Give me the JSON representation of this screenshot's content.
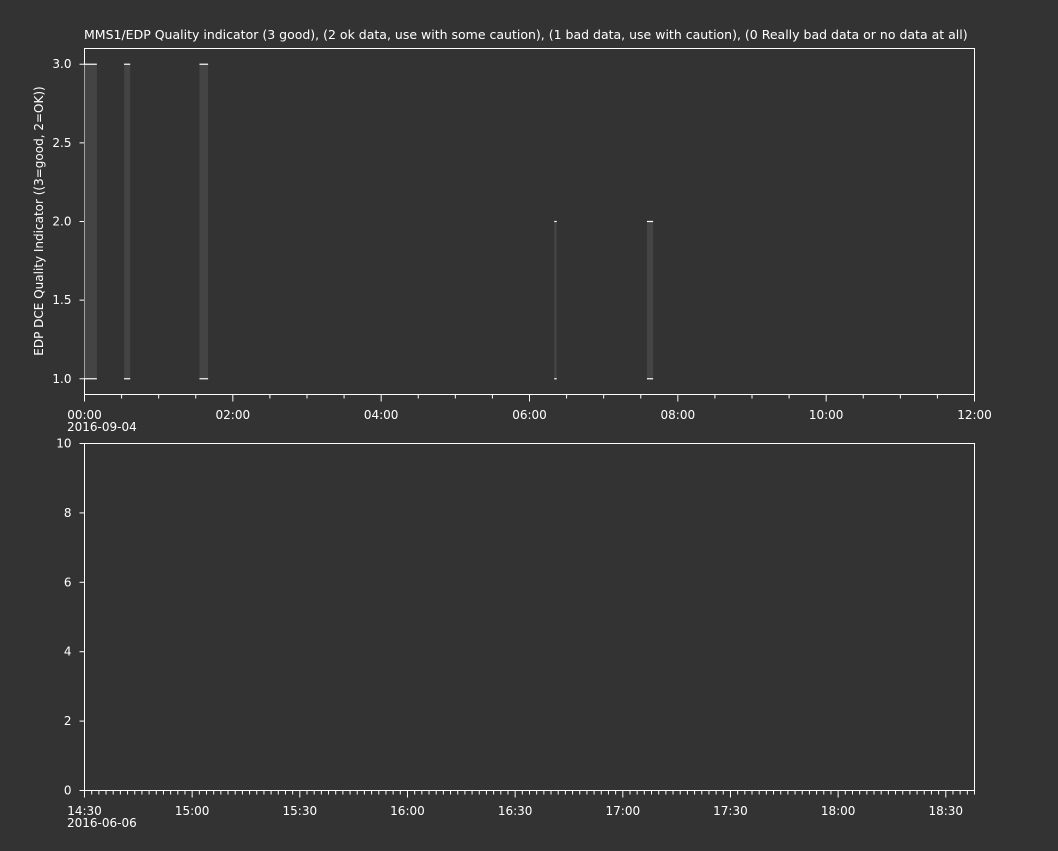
{
  "colors": {
    "background": "#333333",
    "axis": "#ffffff",
    "text": "#ffffff",
    "bar_fill": "#444444",
    "bar_cap": "#ffffff"
  },
  "chart_data": [
    {
      "type": "bar",
      "title": "MMS1/EDP  Quality indicator (3 good), (2 ok data, use with some caution), (1 bad data, use with caution), (0 Really bad data or no data at all)",
      "ylabel": "EDP DCE Quality Indicator ((3=good, 2=OK))",
      "xlabel": "",
      "date_label": "2016-09-04",
      "xlim": [
        "00:00",
        "12:00"
      ],
      "ylim": [
        0.9,
        3.1
      ],
      "x_ticks": [
        "00:00",
        "02:00",
        "04:00",
        "06:00",
        "08:00",
        "10:00",
        "12:00"
      ],
      "y_ticks": [
        "1.0",
        "1.5",
        "2.0",
        "2.5",
        "3.0"
      ],
      "grid": false,
      "segments": [
        {
          "start": "00:00",
          "end": "00:10",
          "value": 3
        },
        {
          "start": "00:32",
          "end": "00:37",
          "value": 3
        },
        {
          "start": "01:33",
          "end": "01:40",
          "value": 3
        },
        {
          "start": "06:20",
          "end": "06:22",
          "value": 2
        },
        {
          "start": "07:35",
          "end": "07:40",
          "value": 2
        }
      ]
    },
    {
      "type": "line",
      "title": "",
      "ylabel": "",
      "xlabel": "",
      "date_label": "2016-06-06",
      "xlim": [
        "14:30",
        "18:38"
      ],
      "ylim": [
        0,
        10
      ],
      "x_ticks": [
        "14:30",
        "15:00",
        "15:30",
        "16:00",
        "16:30",
        "17:00",
        "17:30",
        "18:00",
        "18:30"
      ],
      "y_ticks": [
        "0",
        "2",
        "4",
        "6",
        "8",
        "10"
      ],
      "grid": false,
      "series": []
    }
  ]
}
